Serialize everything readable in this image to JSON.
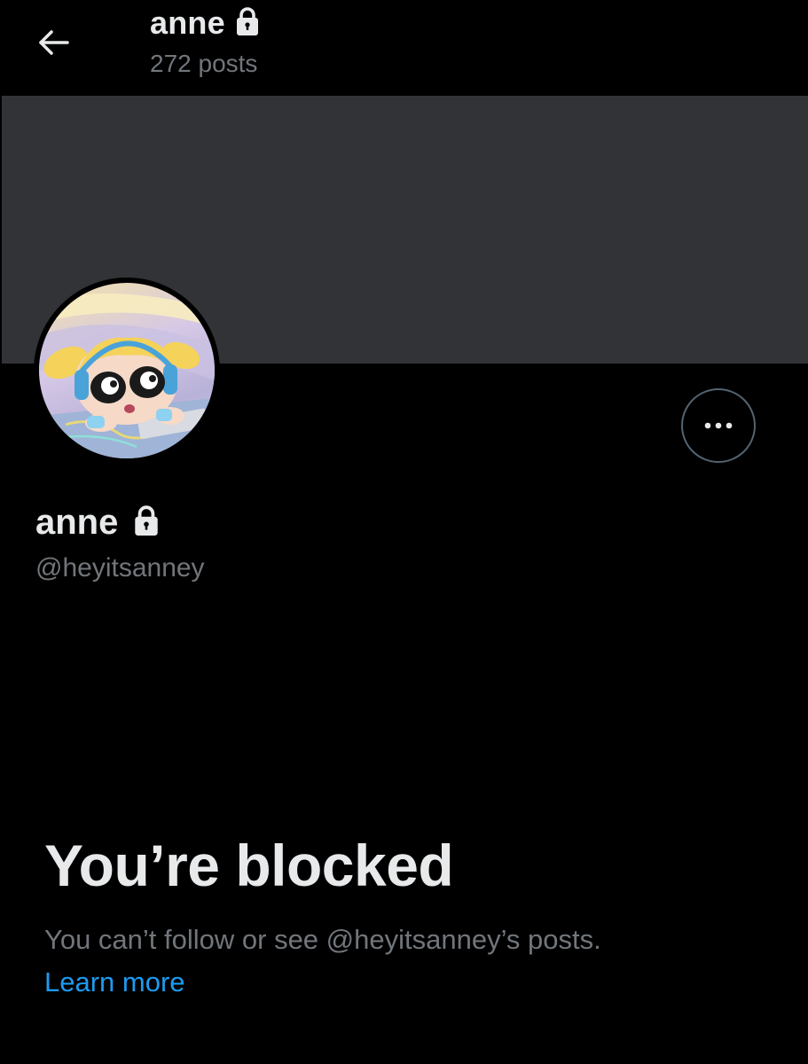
{
  "header": {
    "display_name": "anne",
    "posts_count": "272 posts"
  },
  "profile": {
    "display_name": "anne",
    "handle": "@heyitsanney",
    "protected_icon": "lock-icon",
    "avatar_icon": "avatar-cartoon"
  },
  "actions": {
    "back_icon": "arrow-left-icon",
    "more_icon": "more-horizontal-icon"
  },
  "blocked_notice": {
    "title": "You’re blocked",
    "message": "You can’t follow or see @heyitsanney’s posts.",
    "link_label": "Learn more"
  },
  "colors": {
    "background": "#000000",
    "banner": "#323337",
    "primary_text": "#e7e9ea",
    "secondary_text": "#71767b",
    "link": "#1d9bf0",
    "button_border": "#536471"
  }
}
